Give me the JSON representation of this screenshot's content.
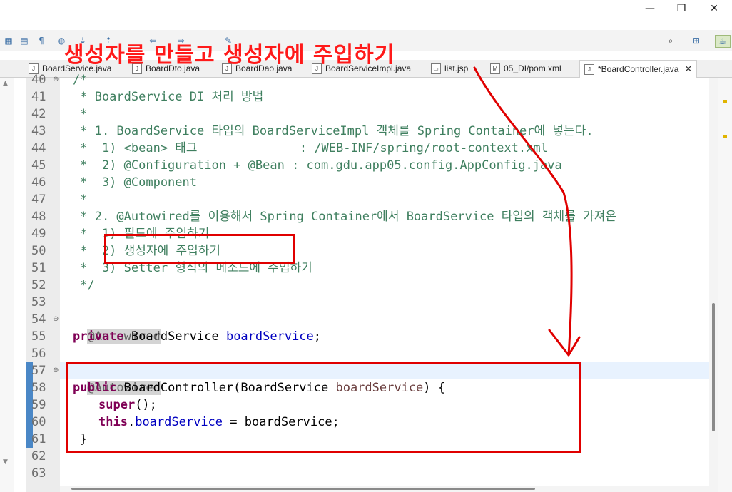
{
  "window": {
    "controls": {
      "minimize": "—",
      "maximize": "❐",
      "close": "✕"
    }
  },
  "annotation": {
    "text": "생성자를 만들고 생성자에 주입하기",
    "color": "#ff1a1a"
  },
  "tabs": [
    {
      "label": "BoardService.java",
      "icon": "java-file-icon",
      "active": false
    },
    {
      "label": "BoardDto.java",
      "icon": "java-file-icon",
      "active": false
    },
    {
      "label": "BoardDao.java",
      "icon": "java-file-icon",
      "active": false
    },
    {
      "label": "BoardServiceImpl.java",
      "icon": "java-file-icon",
      "active": false
    },
    {
      "label": "list.jsp",
      "icon": "jsp-file-icon",
      "active": false
    },
    {
      "label": "05_DI/pom.xml",
      "icon": "maven-file-icon",
      "active": false
    },
    {
      "label": "*BoardController.java",
      "icon": "java-file-icon",
      "active": true
    }
  ],
  "editor": {
    "line_numbers": [
      "40",
      "41",
      "42",
      "43",
      "44",
      "45",
      "46",
      "47",
      "48",
      "49",
      "50",
      "51",
      "52",
      "53",
      "54",
      "55",
      "56",
      "57",
      "58",
      "59",
      "60",
      "61",
      "62",
      "63"
    ],
    "lines": {
      "l40": "/*",
      "l41": " * BoardService DI 처리 방법",
      "l42": " *",
      "l43": " * 1. BoardService 타입의 BoardServiceImpl 객체를 Spring Container에 넣는다.",
      "l44": " *  1) <bean> 태그              : /WEB-INF/spring/root-context.xml",
      "l45": " *  2) @Configuration + @Bean : com.gdu.app05.config.AppConfig.java",
      "l46": " *  3) @Component",
      "l47": " *",
      "l48": " * 2. @Autowired를 이용해서 Spring Container에서 BoardService 타입의 객체를 가져온",
      "l49": " *  1) 필드에 주입하기",
      "l50": " *  2) 생성자에 주입하기",
      "l51": " *  3) Setter 형식의 메소드에 주입하기",
      "l52": " */",
      "l54_ann": "@Autowired",
      "l55_kw": "private",
      "l55_type": " BoardService ",
      "l55_field": "boardService",
      "l55_end": ";",
      "l57_ann": "@Autowired",
      "l58_kw": "public",
      "l58_rest": " BoardController(BoardService ",
      "l58_param": "boardService",
      "l58_end": ") {",
      "l59_kw": "super",
      "l59_end": "();",
      "l60_kw": "this",
      "l60_dot": ".",
      "l60_field": "boardService",
      "l60_end": " = boardService;",
      "l61": "}"
    }
  },
  "colors": {
    "comment": "#3f7f5f",
    "keyword": "#7f0055",
    "field": "#0000c0",
    "annotation": "#646464",
    "highlight_box": "#e00000"
  }
}
